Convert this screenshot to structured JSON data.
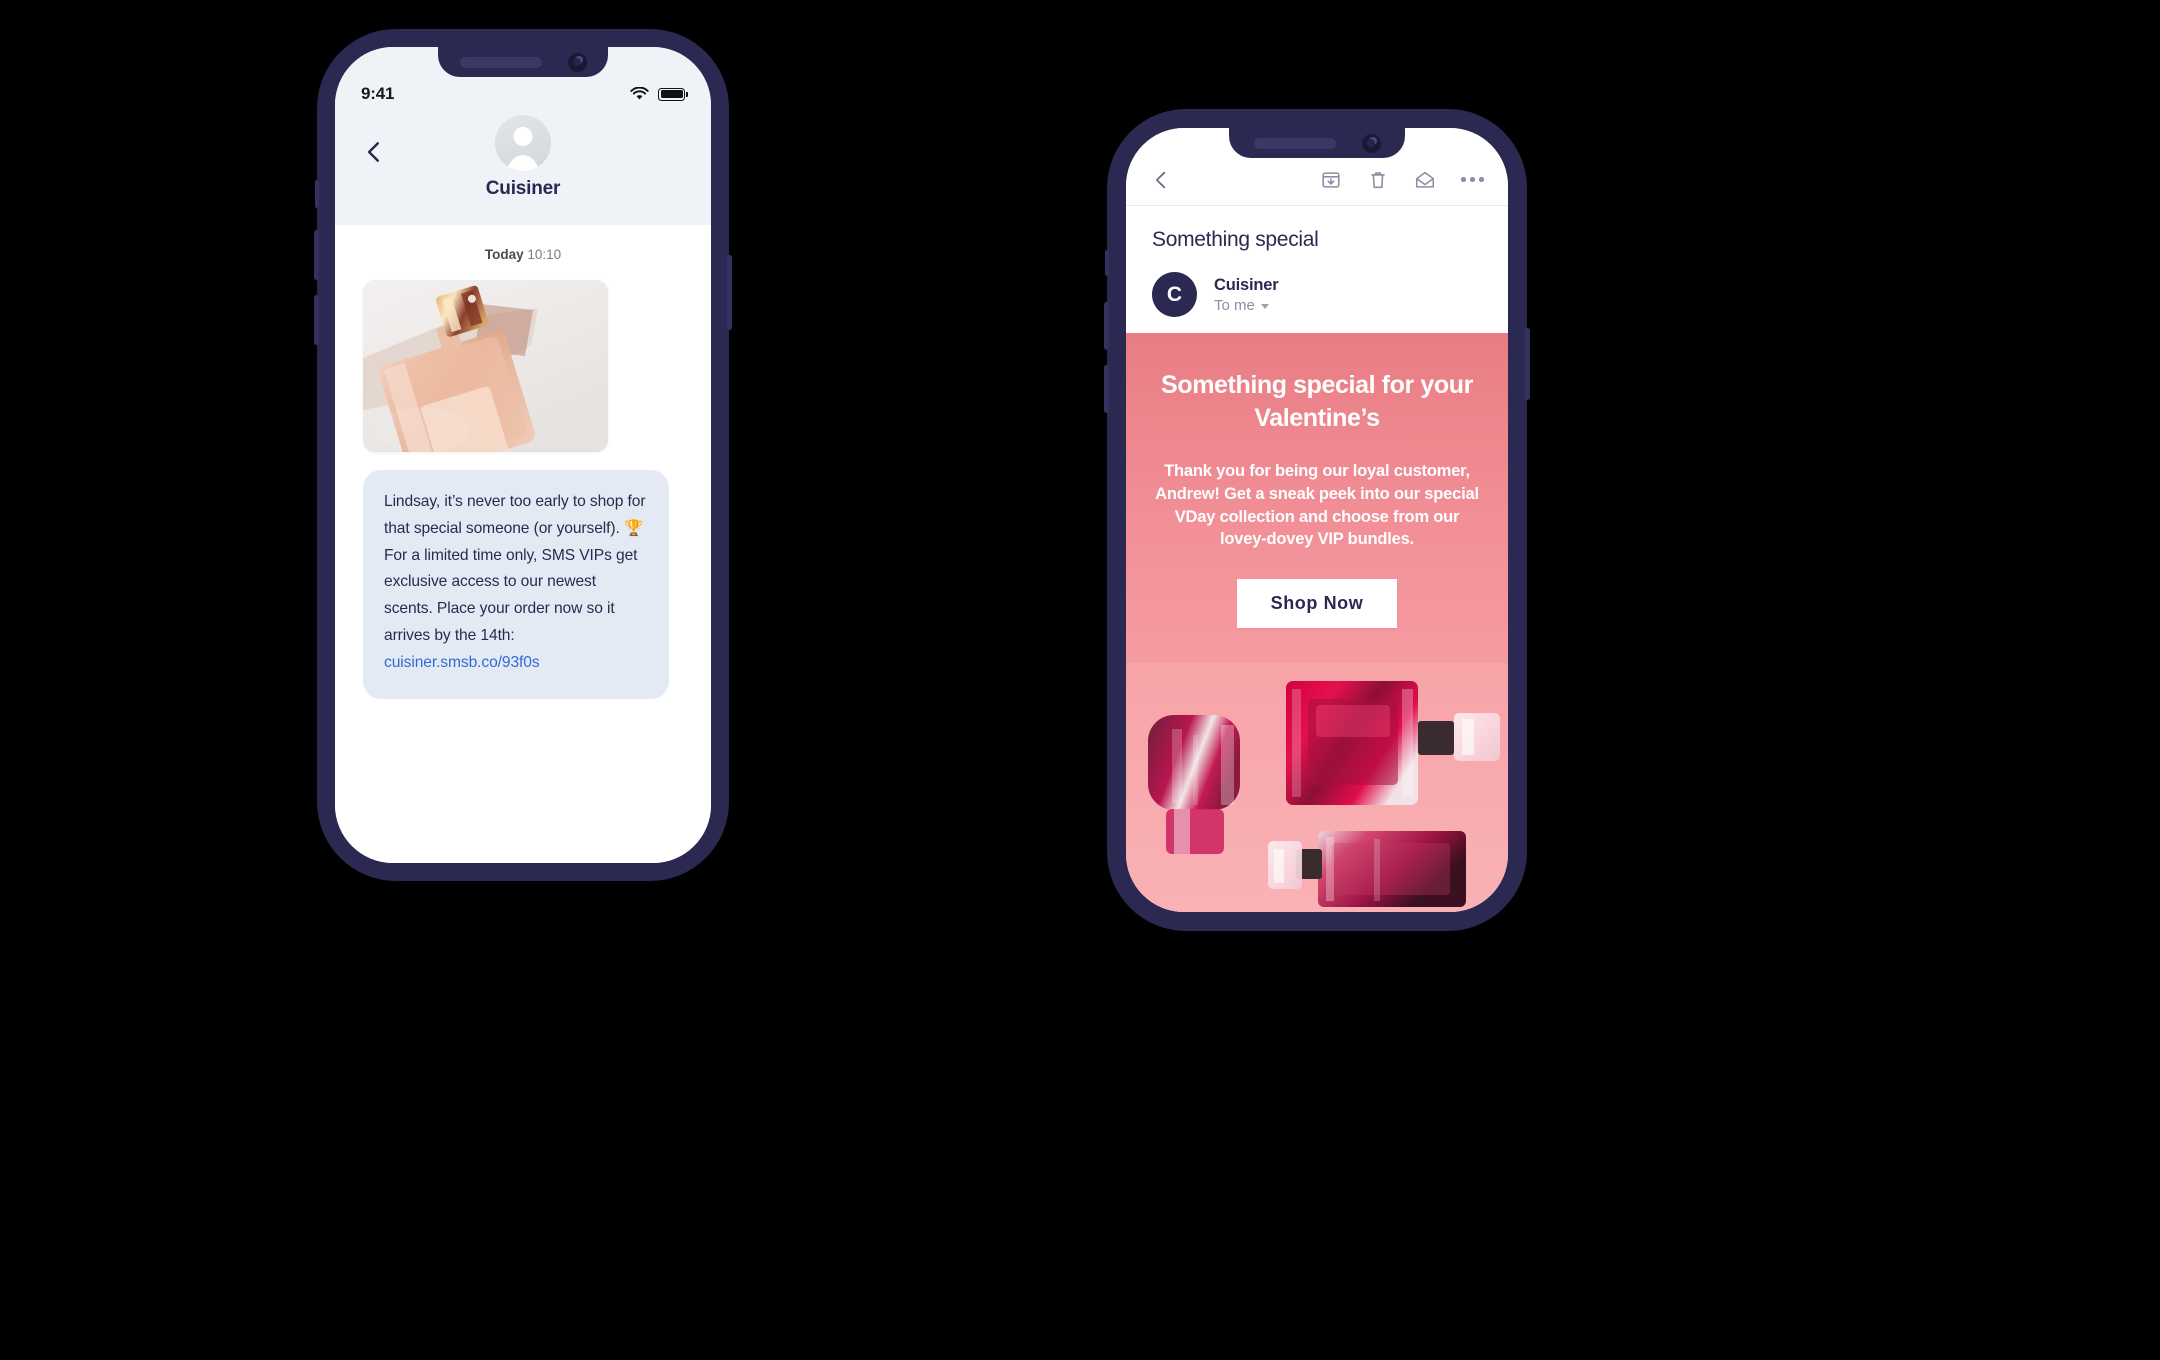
{
  "canvas": {
    "background": "#000000"
  },
  "theme": {
    "frame_color": "#2b2951",
    "sms_header_bg": "#eff2f6",
    "bubble_bg": "#e4eaf4",
    "link_color": "#2f6bd8",
    "email_pink_top": "#e97d84",
    "email_pink_bottom": "#f9acb0",
    "navy": "#2b2951"
  },
  "phone_sms": {
    "status_bar": {
      "time": "9:41",
      "wifi_icon": "wifi-icon",
      "battery_icon": "battery-icon"
    },
    "nav": {
      "back_icon": "chevron-left-icon"
    },
    "contact": {
      "avatar_icon": "person-avatar-icon",
      "name": "Cuisiner"
    },
    "conversation": {
      "day_label": "Today",
      "time_label": "10:10",
      "attachment_alt": "rose-gold perfume bottle photo",
      "message": "Lindsay, it’s never too early to shop for that special someone (or yourself). 🏆 For a limited time only, SMS VIPs get exclusive access to our newest scents. Place your order now so it arrives by the 14th: ",
      "message_link": "cuisiner.smsb.co/93f0s"
    }
  },
  "phone_email": {
    "toolbar": {
      "back_icon": "chevron-left-icon",
      "archive_icon": "archive-icon",
      "delete_icon": "trash-icon",
      "unread_icon": "envelope-open-icon",
      "more_icon": "more-options-icon"
    },
    "message": {
      "subject": "Something special",
      "sender_initial": "C",
      "sender_name": "Cuisiner",
      "recipient": "To me",
      "recipient_chevron_icon": "chevron-down-icon"
    },
    "body": {
      "heading": "Something special for your Valentine’s",
      "paragraph": "Thank you for being our loyal customer, Andrew! Get a sneak peek into our special VDay collection and choose from our lovey-dovey VIP bundles.",
      "cta_label": "Shop Now",
      "image_alt": "three pink perfume bottles on pink background"
    }
  }
}
